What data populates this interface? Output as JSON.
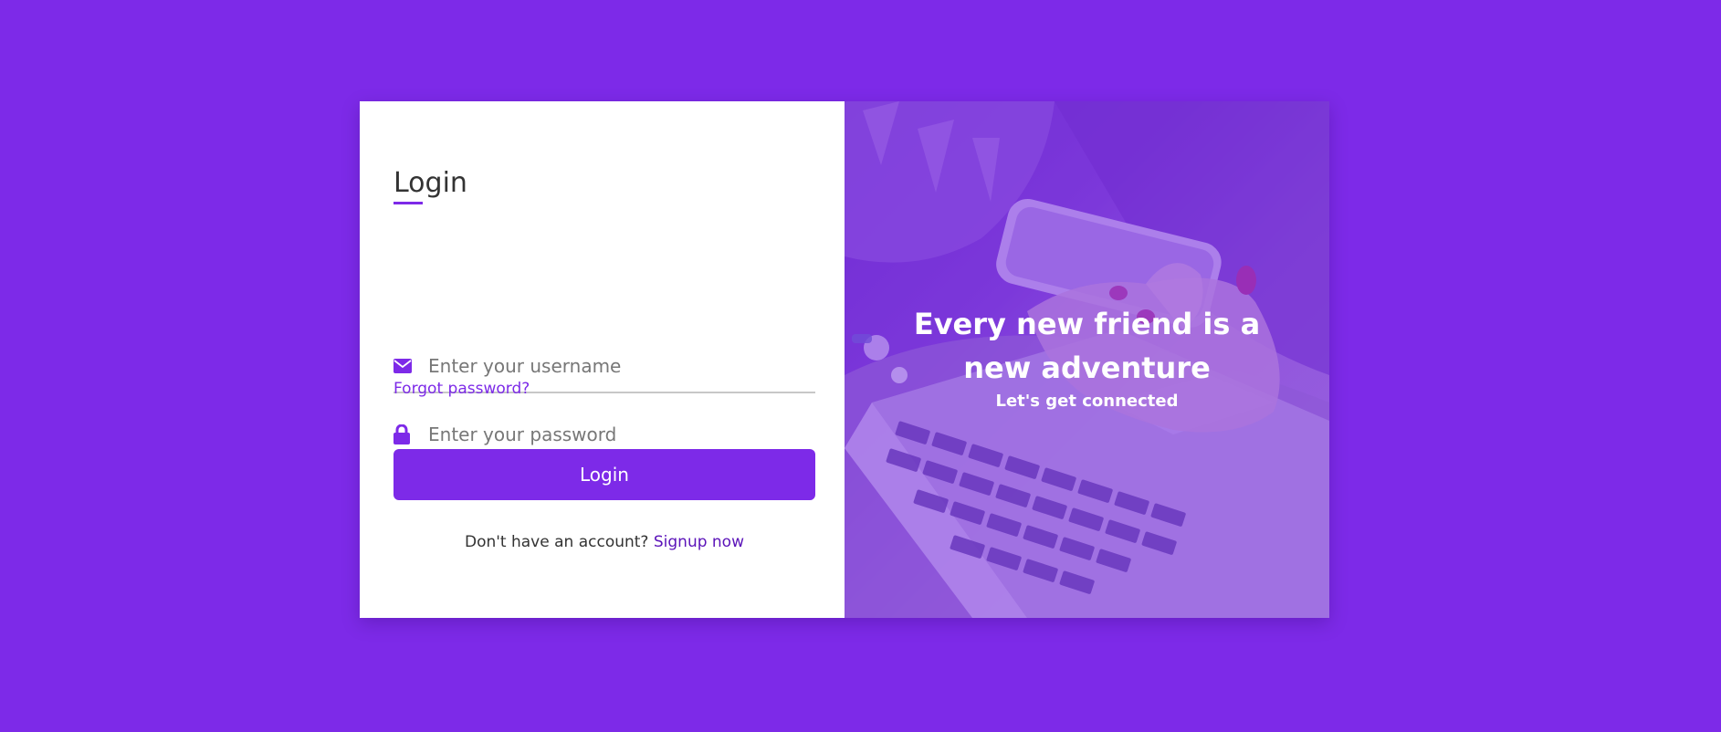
{
  "login_form": {
    "title": "Login",
    "username": {
      "placeholder": "Enter your username",
      "value": ""
    },
    "password": {
      "placeholder": "Enter your password",
      "value": ""
    },
    "forgot_password": "Forgot password?",
    "submit_label": "Login",
    "signup_prompt": "Don't have an account?",
    "signup_link": "Signup now"
  },
  "hero": {
    "headline": "Every new friend is a new adventure",
    "subheadline": "Let's get connected"
  },
  "icons": {
    "username": "envelope-icon",
    "password": "lock-icon"
  },
  "colors": {
    "accent": "#7d2ae8",
    "background": "#7d2ae8",
    "link_dark": "#5b13b9",
    "panel": "#ffffff"
  }
}
